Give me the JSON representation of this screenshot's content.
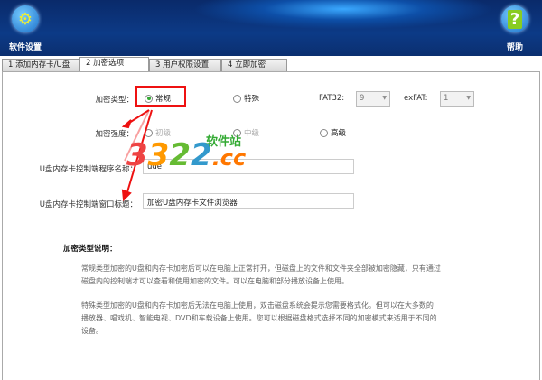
{
  "header": {
    "settings_label": "软件设置",
    "help_label": "帮助",
    "settings_icon": "gear-icon",
    "help_icon": "question-icon"
  },
  "tabs": [
    {
      "label": "1 添加内存卡/U盘"
    },
    {
      "label": "2 加密选项"
    },
    {
      "label": "3 用户权限设置"
    },
    {
      "label": "4 立即加密"
    }
  ],
  "form": {
    "type_label": "加密类型：",
    "type_options": [
      {
        "label": "常规",
        "selected": true
      },
      {
        "label": "特殊",
        "selected": false
      }
    ],
    "fat32_label": "FAT32:",
    "fat32_value": "9",
    "exfat_label": "exFAT:",
    "exfat_value": "1",
    "strength_label": "加密强度：",
    "strength_options": [
      {
        "label": "初级",
        "enabled": false
      },
      {
        "label": "中级",
        "enabled": false
      },
      {
        "label": "高级",
        "enabled": true
      }
    ],
    "program_name_label": "U盘内存卡控制端程序名称：",
    "program_name_value": "ude",
    "window_title_label": "U盘内存卡控制端窗口标题：",
    "window_title_value": "加密U盘内存卡文件浏览器"
  },
  "description": {
    "title": "加密类型说明：",
    "paragraph1": "常规类型加密的U盘和内存卡加密后可以在电脑上正常打开，但磁盘上的文件和文件夹全部被加密隐藏，只有通过磁盘内的控制端才可以查看和使用加密的文件。可以在电脑和部分播放设备上使用。",
    "paragraph2": "特殊类型加密的U盘和内存卡加密后无法在电脑上使用，双击磁盘系统会提示您需要格式化。但可以在大多数的播放器、唱戏机、智能电视、DVD和车载设备上使用。您可以根据磁盘格式选择不同的加密模式来适用于不同的设备。"
  },
  "watermark": {
    "text": "3322.cc",
    "subtext": "软件站"
  },
  "colors": {
    "annotation": "#e11111",
    "header": "#0c3a86"
  }
}
